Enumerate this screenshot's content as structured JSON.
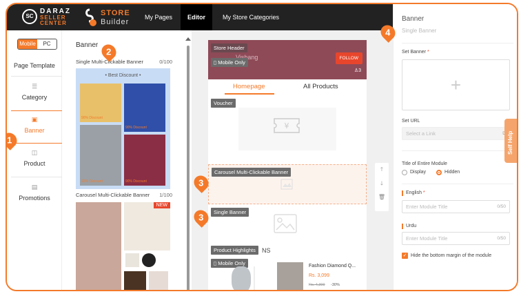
{
  "logo": {
    "l1": "DARAZ",
    "l2": "SELLER",
    "l3": "CENTER",
    "badge": "SC"
  },
  "store_builder": {
    "store": "STORE",
    "builder": "Builder"
  },
  "nav": {
    "my_pages": "My Pages",
    "editor": "Editor",
    "categories": "My Store Categories"
  },
  "toggle": {
    "mobile": "Mobile",
    "pc": "PC"
  },
  "leftnav": {
    "page_template": "Page Template",
    "category": "Category",
    "banner": "Banner",
    "product": "Product",
    "promotions": "Promotions"
  },
  "panel": {
    "title": "Banner",
    "comp1_name": "Single Multi-Clickable Banner",
    "comp1_count": "0/100",
    "comp1_badge": "Best Discount",
    "discount_tag": "90% Discount",
    "comp2_name": "Carousel Multi-Clickable Banner",
    "comp2_count": "1/100",
    "new_tag": "NEW"
  },
  "canvas": {
    "store_header": "Store Header",
    "mobile_only": "Mobile Only",
    "shop_name": "Vishang",
    "follow": "FOLLOW",
    "followers": "3",
    "tab_home": "Homepage",
    "tab_all": "All Products",
    "voucher": "Voucher",
    "carousel": "Carousel Multi-Clickable Banner",
    "single": "Single Banner",
    "highlights": "Product Highlights",
    "highlights_tail": "NS",
    "mobile_only2": "Mobile Only",
    "product_title": "Fashion Diamond Q...",
    "price": "Rs. 3,099",
    "old_price": "Rs. 4,399",
    "discount": "-30%"
  },
  "settings": {
    "title": "Banner",
    "subtitle": "Single Banner",
    "set_banner": "Set Banner",
    "set_url": "Set URL",
    "link_placeholder": "Select a Link",
    "title_module": "Title of Entire Module",
    "display": "Display",
    "hidden": "Hidden",
    "english": "English",
    "module_title_placeholder": "Enter Module Title",
    "title_count": "0/50",
    "urdu": "Urdu",
    "hide_margin": "Hide the bottom margin of the module"
  },
  "self_help": "Self Help",
  "markers": [
    "1",
    "2",
    "3",
    "3",
    "4"
  ],
  "colors": {
    "accent": "#f47a2a",
    "topbar": "#222222",
    "header_bg": "#8e4a57"
  }
}
